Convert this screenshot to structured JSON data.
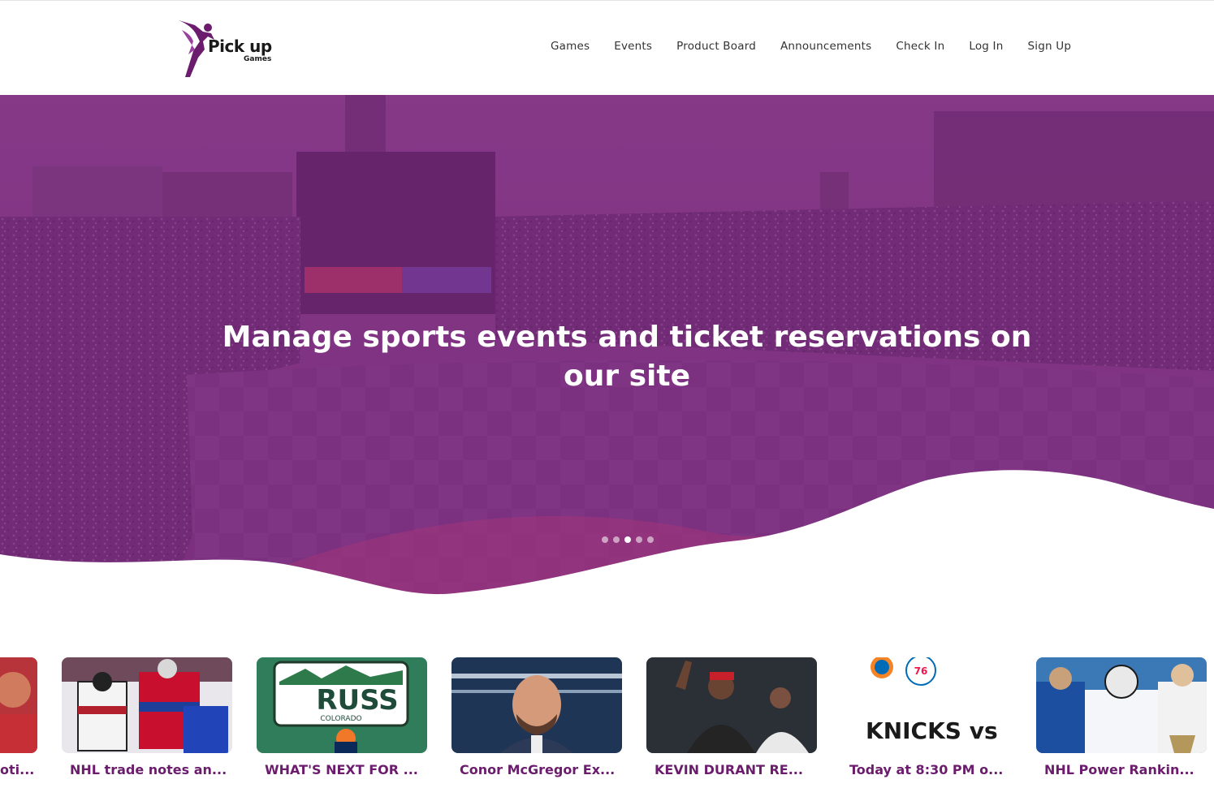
{
  "brand": {
    "logo_main": "Pick up",
    "logo_sub": "Games",
    "accent": "#7b2d7f"
  },
  "nav": {
    "items": [
      {
        "label": "Games"
      },
      {
        "label": "Events"
      },
      {
        "label": "Product Board"
      },
      {
        "label": "Announcements"
      },
      {
        "label": "Check In"
      },
      {
        "label": "Log In"
      },
      {
        "label": "Sign Up"
      }
    ]
  },
  "hero": {
    "title": "Manage sports events and ticket reservations on our site",
    "slide_count": 5,
    "active_slide": 3,
    "overlay_color": "#7b2d7f"
  },
  "news": [
    {
      "title": "oti...",
      "image": "soccer-player"
    },
    {
      "title": "NHL trade notes an...",
      "image": "hockey-game"
    },
    {
      "title": "WHAT'S NEXT FOR ...",
      "image": "russ-license-plate",
      "plate_text": "RUSS",
      "plate_state": "COLORADO"
    },
    {
      "title": "Conor McGregor Ex...",
      "image": "fighter-portrait"
    },
    {
      "title": "KEVIN DURANT RE...",
      "image": "basketball-players"
    },
    {
      "title": "Today at 8:30 PM o...",
      "image": "knicks-vs-76ers",
      "matchup_text": "KNICKS vs"
    },
    {
      "title": "NHL Power Rankin...",
      "image": "hockey-players"
    }
  ]
}
